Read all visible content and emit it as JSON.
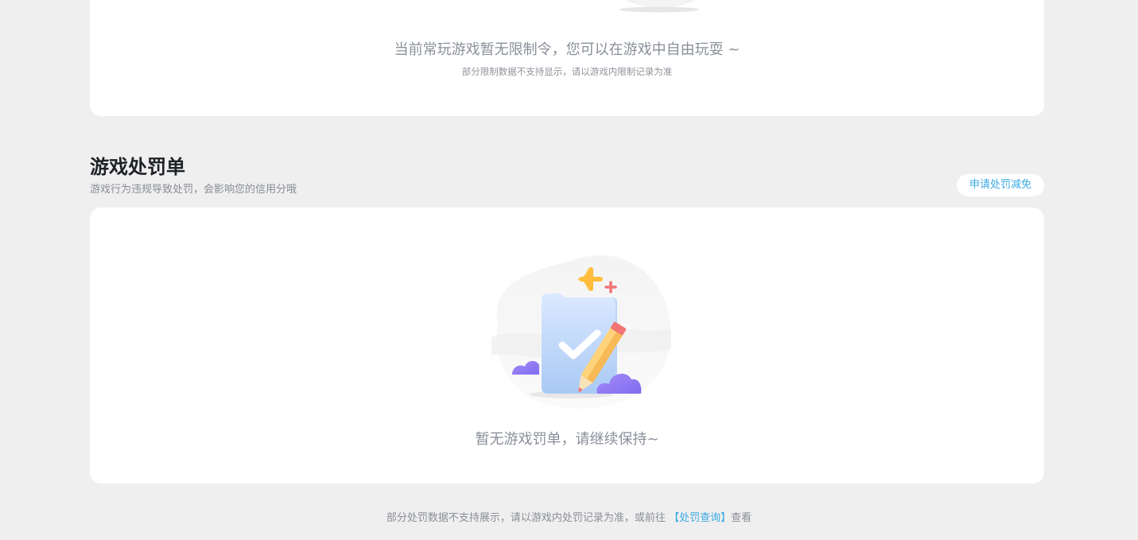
{
  "restrictions": {
    "message": "当前常玩游戏暂无限制令，您可以在游戏中自由玩耍 ~",
    "note": "部分限制数据不支持显示，请以游戏内限制记录为准"
  },
  "penalties": {
    "title": "游戏处罚单",
    "subtitle": "游戏行为违规导致处罚，会影响您的信用分哦",
    "appeal_button": "申请处罚减免",
    "empty_text": "暂无游戏罚单，请继续保持~"
  },
  "footer": {
    "prefix": "部分处罚数据不支持展示，请以游戏内处罚记录为准，或前往",
    "link": "【处罚查询】",
    "suffix": "查看"
  },
  "colors": {
    "accent": "#3aa9e4",
    "background": "#efefef",
    "card": "#ffffff"
  },
  "icons": {
    "empty_illustration": "folder-check-pencil-illustration",
    "top_illustration": "partial-illustration"
  }
}
